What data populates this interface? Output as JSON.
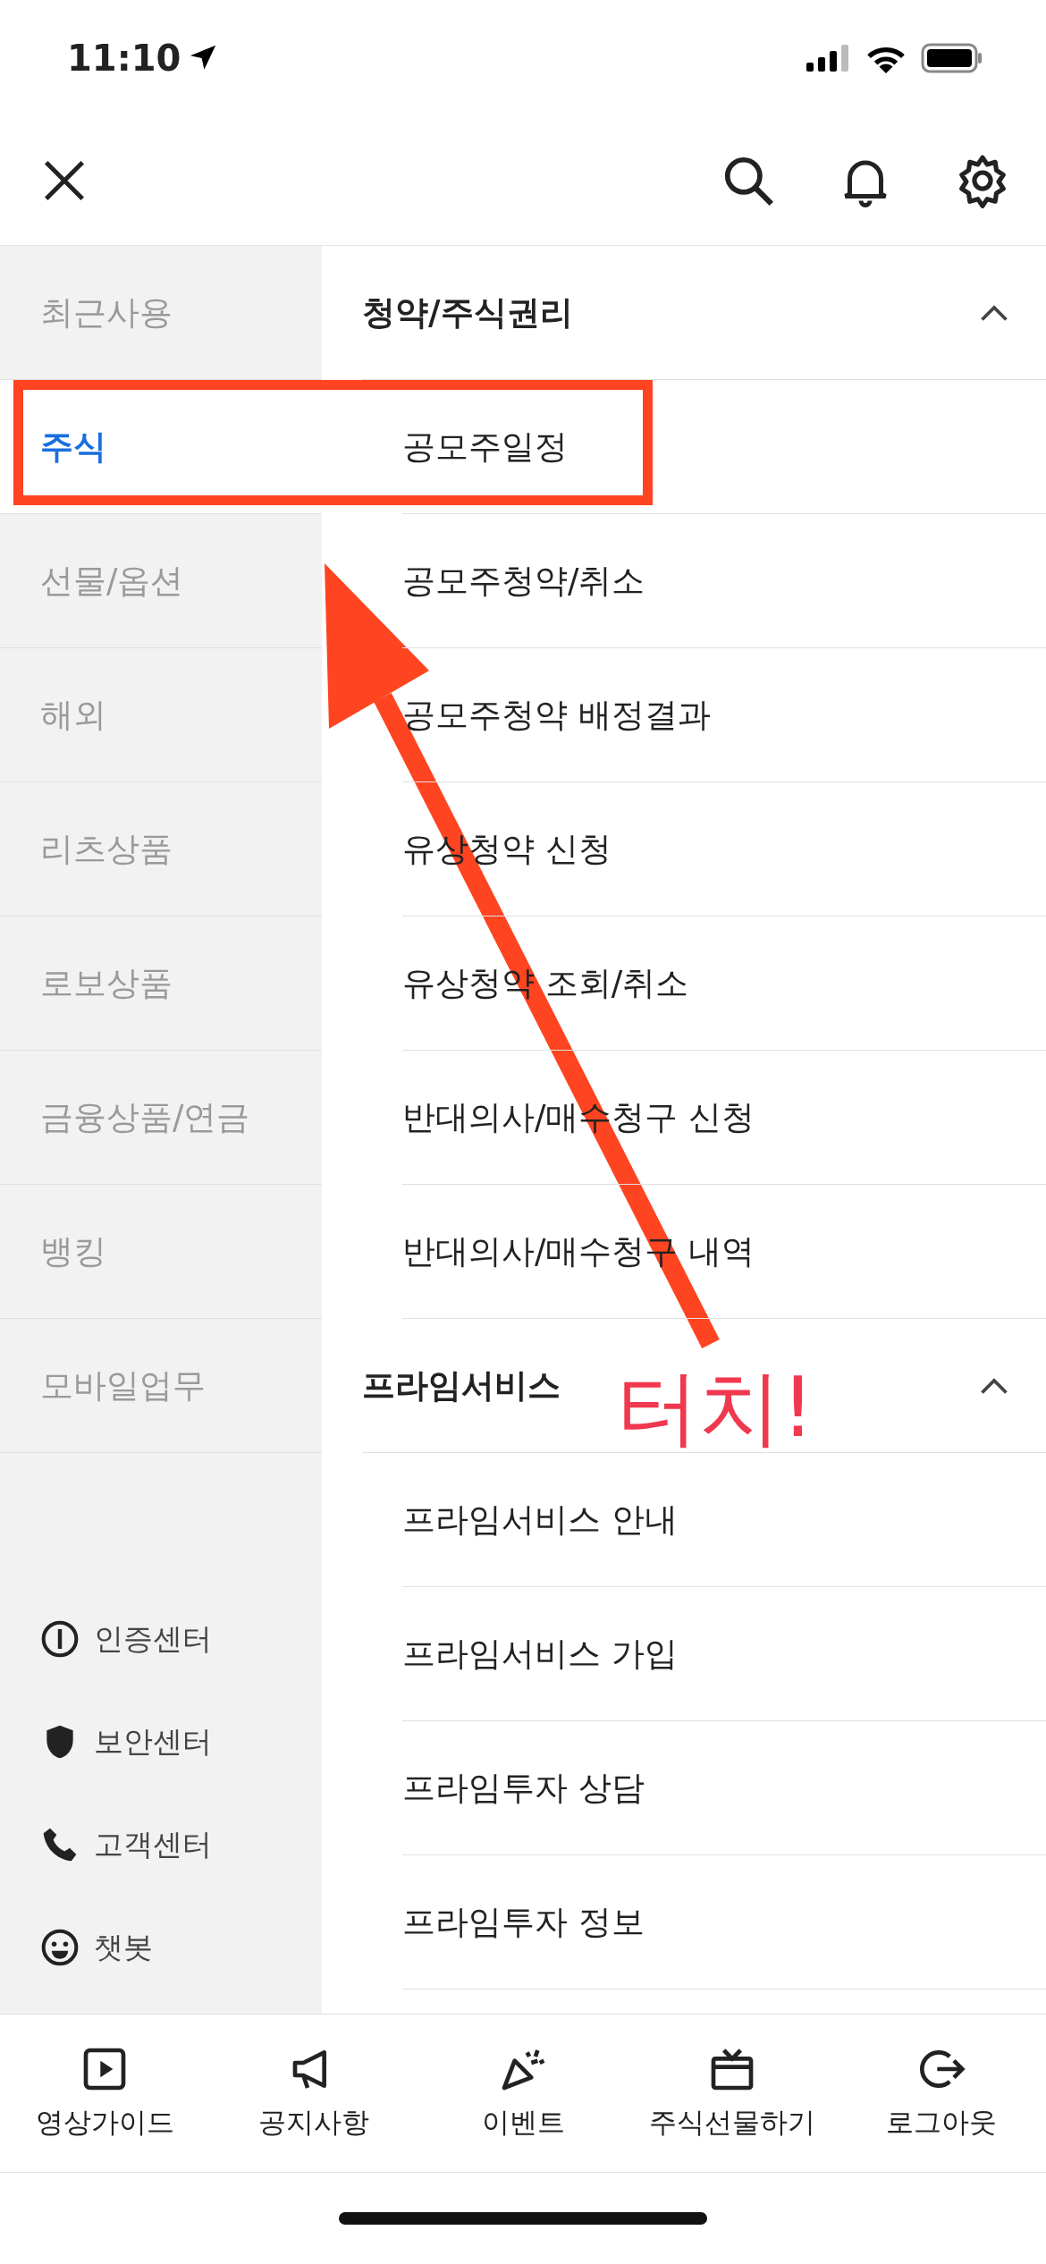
{
  "status_bar": {
    "time": "11:10"
  },
  "sidebar": {
    "items": [
      {
        "label": "최근사용",
        "selected": false
      },
      {
        "label": "주식",
        "selected": true
      },
      {
        "label": "선물/옵션",
        "selected": false
      },
      {
        "label": "해외",
        "selected": false
      },
      {
        "label": "리츠상품",
        "selected": false
      },
      {
        "label": "로보상품",
        "selected": false
      },
      {
        "label": "금융상품/연금",
        "selected": false
      },
      {
        "label": "뱅킹",
        "selected": false
      },
      {
        "label": "모바일업무",
        "selected": false
      }
    ],
    "links": [
      {
        "label": "인증센터",
        "kind": "certificate"
      },
      {
        "label": "보안센터",
        "kind": "shield"
      },
      {
        "label": "고객센터",
        "kind": "phone"
      },
      {
        "label": "챗봇",
        "kind": "smiley"
      }
    ]
  },
  "menu": {
    "sections": [
      {
        "title": "청약/주식권리",
        "expanded": true,
        "items": [
          "공모주일정",
          "공모주청약/취소",
          "공모주청약 배정결과",
          "유상청약 신청",
          "유상청약 조회/취소",
          "반대의사/매수청구 신청",
          "반대의사/매수청구 내역"
        ]
      },
      {
        "title": "프라임서비스",
        "expanded": true,
        "items": [
          "프라임서비스 안내",
          "프라임서비스 가입",
          "프라임투자 상담",
          "프라임투자 정보"
        ]
      }
    ]
  },
  "tab_bar": {
    "items": [
      {
        "label": "영상가이드",
        "kind": "play"
      },
      {
        "label": "공지사항",
        "kind": "megaphone"
      },
      {
        "label": "이벤트",
        "kind": "party"
      },
      {
        "label": "주식선물하기",
        "kind": "gift"
      },
      {
        "label": "로그아웃",
        "kind": "logout"
      }
    ]
  },
  "annotation": {
    "text": "터치!"
  }
}
